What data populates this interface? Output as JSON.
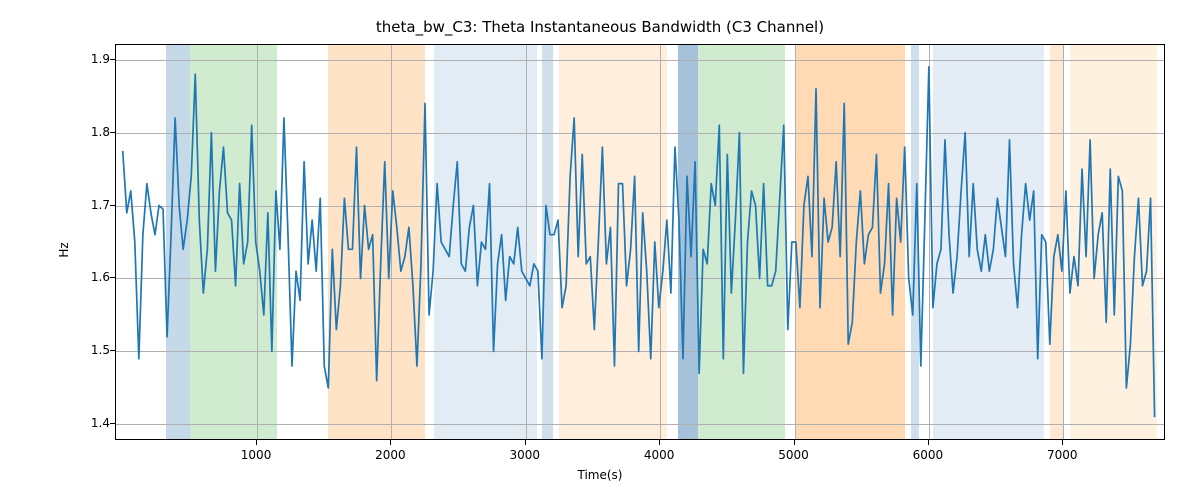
{
  "chart_data": {
    "type": "line",
    "title": "theta_bw_C3: Theta Instantaneous Bandwidth (C3 Channel)",
    "xlabel": "Time(s)",
    "ylabel": "Hz",
    "xlim": [
      -50,
      7750
    ],
    "ylim": [
      1.38,
      1.92
    ],
    "xticks": [
      1000,
      2000,
      3000,
      4000,
      5000,
      6000,
      7000
    ],
    "yticks": [
      1.4,
      1.5,
      1.6,
      1.7,
      1.8,
      1.9
    ],
    "xtick_labels": [
      "1000",
      "2000",
      "3000",
      "4000",
      "5000",
      "6000",
      "7000"
    ],
    "ytick_labels": [
      "1.4",
      "1.5",
      "1.6",
      "1.7",
      "1.8",
      "1.9"
    ],
    "bands": [
      {
        "x0": 320,
        "x1": 500,
        "color": "#a7c4dd",
        "alpha": 0.65
      },
      {
        "x0": 500,
        "x1": 1150,
        "color": "#b8e0b8",
        "alpha": 0.65
      },
      {
        "x0": 1530,
        "x1": 2250,
        "color": "#ffd9b3",
        "alpha": 0.75
      },
      {
        "x0": 2320,
        "x1": 3080,
        "color": "#d6e4f0",
        "alpha": 0.7
      },
      {
        "x0": 3120,
        "x1": 3200,
        "color": "#a7c4dd",
        "alpha": 0.55
      },
      {
        "x0": 3250,
        "x1": 4050,
        "color": "#ffe7cc",
        "alpha": 0.7
      },
      {
        "x0": 4130,
        "x1": 4280,
        "color": "#88aecf",
        "alpha": 0.75
      },
      {
        "x0": 4280,
        "x1": 4930,
        "color": "#b8e0b8",
        "alpha": 0.65
      },
      {
        "x0": 5010,
        "x1": 5820,
        "color": "#ffd1a3",
        "alpha": 0.8
      },
      {
        "x0": 5870,
        "x1": 5930,
        "color": "#a7c4dd",
        "alpha": 0.55
      },
      {
        "x0": 6030,
        "x1": 6860,
        "color": "#d9e6f2",
        "alpha": 0.7
      },
      {
        "x0": 6900,
        "x1": 7000,
        "color": "#ffd9b3",
        "alpha": 0.6
      },
      {
        "x0": 7050,
        "x1": 7700,
        "color": "#ffe7cc",
        "alpha": 0.6
      }
    ],
    "line_color": "#1f77b4",
    "x": [
      0,
      30,
      60,
      90,
      120,
      150,
      180,
      210,
      240,
      270,
      300,
      330,
      360,
      390,
      420,
      450,
      480,
      510,
      540,
      570,
      600,
      630,
      660,
      690,
      720,
      750,
      780,
      810,
      840,
      870,
      900,
      930,
      960,
      990,
      1020,
      1050,
      1080,
      1110,
      1140,
      1170,
      1200,
      1230,
      1260,
      1290,
      1320,
      1350,
      1380,
      1410,
      1440,
      1470,
      1500,
      1530,
      1560,
      1590,
      1620,
      1650,
      1680,
      1710,
      1740,
      1770,
      1800,
      1830,
      1860,
      1890,
      1920,
      1950,
      1980,
      2010,
      2040,
      2070,
      2100,
      2130,
      2160,
      2190,
      2220,
      2250,
      2280,
      2310,
      2340,
      2370,
      2400,
      2430,
      2460,
      2490,
      2520,
      2550,
      2580,
      2610,
      2640,
      2670,
      2700,
      2730,
      2760,
      2790,
      2820,
      2850,
      2880,
      2910,
      2940,
      2970,
      3000,
      3030,
      3060,
      3090,
      3120,
      3150,
      3180,
      3210,
      3240,
      3270,
      3300,
      3330,
      3360,
      3390,
      3420,
      3450,
      3480,
      3510,
      3540,
      3570,
      3600,
      3630,
      3660,
      3690,
      3720,
      3750,
      3780,
      3810,
      3840,
      3870,
      3900,
      3930,
      3960,
      3990,
      4020,
      4050,
      4080,
      4110,
      4140,
      4170,
      4200,
      4230,
      4260,
      4290,
      4320,
      4350,
      4380,
      4410,
      4440,
      4470,
      4500,
      4530,
      4560,
      4590,
      4620,
      4650,
      4680,
      4710,
      4740,
      4770,
      4800,
      4830,
      4860,
      4890,
      4920,
      4950,
      4980,
      5010,
      5040,
      5070,
      5100,
      5130,
      5160,
      5190,
      5220,
      5250,
      5280,
      5310,
      5340,
      5370,
      5400,
      5430,
      5460,
      5490,
      5520,
      5550,
      5580,
      5610,
      5640,
      5670,
      5700,
      5730,
      5760,
      5790,
      5820,
      5850,
      5880,
      5910,
      5940,
      5970,
      6000,
      6030,
      6060,
      6090,
      6120,
      6150,
      6180,
      6210,
      6240,
      6270,
      6300,
      6330,
      6360,
      6390,
      6420,
      6450,
      6480,
      6510,
      6540,
      6570,
      6600,
      6630,
      6660,
      6690,
      6720,
      6750,
      6780,
      6810,
      6840,
      6870,
      6900,
      6930,
      6960,
      6990,
      7020,
      7050,
      7080,
      7110,
      7140,
      7170,
      7200,
      7230,
      7260,
      7290,
      7320,
      7350,
      7380,
      7410,
      7440,
      7470,
      7500,
      7530,
      7560,
      7590,
      7620,
      7650,
      7680
    ],
    "y": [
      1.775,
      1.69,
      1.72,
      1.65,
      1.49,
      1.66,
      1.73,
      1.69,
      1.66,
      1.7,
      1.695,
      1.52,
      1.66,
      1.82,
      1.7,
      1.64,
      1.68,
      1.74,
      1.88,
      1.68,
      1.58,
      1.64,
      1.8,
      1.61,
      1.72,
      1.78,
      1.69,
      1.68,
      1.59,
      1.73,
      1.62,
      1.65,
      1.81,
      1.65,
      1.61,
      1.55,
      1.69,
      1.5,
      1.72,
      1.64,
      1.82,
      1.66,
      1.48,
      1.61,
      1.57,
      1.76,
      1.62,
      1.68,
      1.61,
      1.71,
      1.48,
      1.45,
      1.64,
      1.53,
      1.59,
      1.71,
      1.64,
      1.64,
      1.78,
      1.6,
      1.7,
      1.64,
      1.66,
      1.46,
      1.62,
      1.76,
      1.6,
      1.72,
      1.67,
      1.61,
      1.63,
      1.67,
      1.59,
      1.48,
      1.62,
      1.84,
      1.55,
      1.61,
      1.73,
      1.65,
      1.64,
      1.63,
      1.7,
      1.76,
      1.62,
      1.61,
      1.67,
      1.7,
      1.59,
      1.65,
      1.64,
      1.73,
      1.5,
      1.62,
      1.66,
      1.57,
      1.63,
      1.62,
      1.67,
      1.61,
      1.6,
      1.59,
      1.62,
      1.61,
      1.49,
      1.7,
      1.66,
      1.66,
      1.68,
      1.56,
      1.59,
      1.74,
      1.82,
      1.63,
      1.77,
      1.62,
      1.63,
      1.53,
      1.65,
      1.78,
      1.62,
      1.67,
      1.48,
      1.73,
      1.73,
      1.59,
      1.64,
      1.74,
      1.5,
      1.69,
      1.61,
      1.49,
      1.65,
      1.56,
      1.61,
      1.68,
      1.58,
      1.78,
      1.68,
      1.49,
      1.74,
      1.63,
      1.76,
      1.47,
      1.64,
      1.62,
      1.73,
      1.7,
      1.81,
      1.49,
      1.77,
      1.58,
      1.68,
      1.8,
      1.47,
      1.65,
      1.72,
      1.7,
      1.6,
      1.73,
      1.59,
      1.59,
      1.61,
      1.71,
      1.81,
      1.53,
      1.65,
      1.65,
      1.56,
      1.7,
      1.74,
      1.63,
      1.86,
      1.56,
      1.71,
      1.65,
      1.67,
      1.76,
      1.63,
      1.84,
      1.51,
      1.54,
      1.65,
      1.72,
      1.62,
      1.66,
      1.67,
      1.77,
      1.58,
      1.62,
      1.73,
      1.55,
      1.71,
      1.65,
      1.78,
      1.6,
      1.55,
      1.73,
      1.48,
      1.68,
      1.89,
      1.56,
      1.62,
      1.64,
      1.79,
      1.66,
      1.58,
      1.63,
      1.72,
      1.8,
      1.63,
      1.73,
      1.64,
      1.61,
      1.66,
      1.61,
      1.64,
      1.71,
      1.67,
      1.63,
      1.79,
      1.62,
      1.56,
      1.66,
      1.73,
      1.68,
      1.72,
      1.49,
      1.66,
      1.65,
      1.51,
      1.63,
      1.66,
      1.61,
      1.72,
      1.58,
      1.63,
      1.59,
      1.75,
      1.63,
      1.79,
      1.6,
      1.66,
      1.69,
      1.54,
      1.75,
      1.55,
      1.74,
      1.72,
      1.45,
      1.51,
      1.63,
      1.71,
      1.59,
      1.61,
      1.71,
      1.41
    ]
  }
}
